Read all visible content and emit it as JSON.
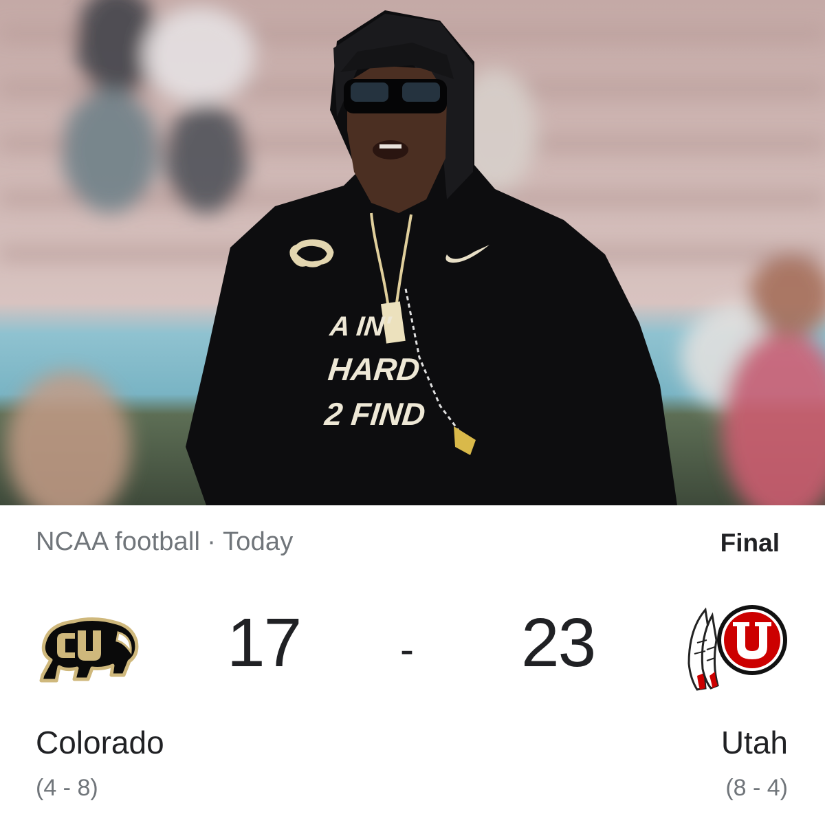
{
  "hero": {
    "shirt_text": [
      "A IN'",
      "HARD",
      "2 FIND"
    ]
  },
  "game": {
    "league": "NCAA football",
    "separator": "·",
    "date": "Today",
    "status": "Final"
  },
  "home_team": {
    "name": "Colorado",
    "record": "(4 - 8)",
    "score": "17",
    "logo_icon": "colorado-buffaloes-logo",
    "colors": {
      "primary": "#000000",
      "accent": "#cfb87c"
    }
  },
  "score_separator": "-",
  "away_team": {
    "name": "Utah",
    "record": "(8 - 4)",
    "score": "23",
    "logo_icon": "utah-utes-logo",
    "colors": {
      "primary": "#cc0000",
      "accent": "#ffffff"
    }
  }
}
